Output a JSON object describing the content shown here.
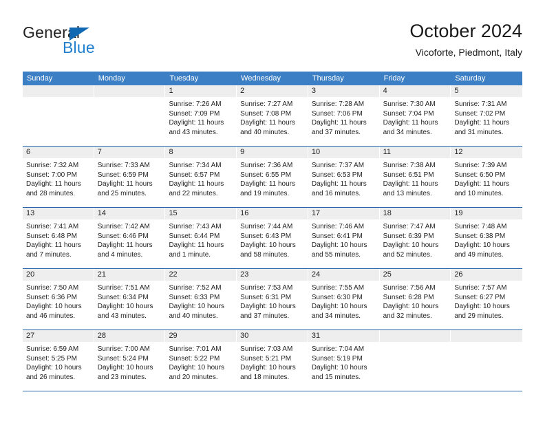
{
  "brand": {
    "name_dark": "General",
    "name_blue": "Blue",
    "accent_color": "#1068b3",
    "blue_text_color": "#1f7fd0"
  },
  "header": {
    "title": "October 2024",
    "subtitle": "Vicoforte, Piedmont, Italy"
  },
  "theme": {
    "header_row_bg": "#3c7fc4",
    "week_divider": "#1f62a8",
    "day_number_bg": "#eeeeee",
    "text_color": "#222222"
  },
  "weekdays": [
    "Sunday",
    "Monday",
    "Tuesday",
    "Wednesday",
    "Thursday",
    "Friday",
    "Saturday"
  ],
  "weeks": [
    [
      {
        "day": "",
        "empty": true,
        "sunrise": "",
        "sunset": "",
        "daylight_1": "",
        "daylight_2": ""
      },
      {
        "day": "",
        "empty": true,
        "sunrise": "",
        "sunset": "",
        "daylight_1": "",
        "daylight_2": ""
      },
      {
        "day": "1",
        "sunrise": "Sunrise: 7:26 AM",
        "sunset": "Sunset: 7:09 PM",
        "daylight_1": "Daylight: 11 hours",
        "daylight_2": "and 43 minutes."
      },
      {
        "day": "2",
        "sunrise": "Sunrise: 7:27 AM",
        "sunset": "Sunset: 7:08 PM",
        "daylight_1": "Daylight: 11 hours",
        "daylight_2": "and 40 minutes."
      },
      {
        "day": "3",
        "sunrise": "Sunrise: 7:28 AM",
        "sunset": "Sunset: 7:06 PM",
        "daylight_1": "Daylight: 11 hours",
        "daylight_2": "and 37 minutes."
      },
      {
        "day": "4",
        "sunrise": "Sunrise: 7:30 AM",
        "sunset": "Sunset: 7:04 PM",
        "daylight_1": "Daylight: 11 hours",
        "daylight_2": "and 34 minutes."
      },
      {
        "day": "5",
        "sunrise": "Sunrise: 7:31 AM",
        "sunset": "Sunset: 7:02 PM",
        "daylight_1": "Daylight: 11 hours",
        "daylight_2": "and 31 minutes."
      }
    ],
    [
      {
        "day": "6",
        "sunrise": "Sunrise: 7:32 AM",
        "sunset": "Sunset: 7:00 PM",
        "daylight_1": "Daylight: 11 hours",
        "daylight_2": "and 28 minutes."
      },
      {
        "day": "7",
        "sunrise": "Sunrise: 7:33 AM",
        "sunset": "Sunset: 6:59 PM",
        "daylight_1": "Daylight: 11 hours",
        "daylight_2": "and 25 minutes."
      },
      {
        "day": "8",
        "sunrise": "Sunrise: 7:34 AM",
        "sunset": "Sunset: 6:57 PM",
        "daylight_1": "Daylight: 11 hours",
        "daylight_2": "and 22 minutes."
      },
      {
        "day": "9",
        "sunrise": "Sunrise: 7:36 AM",
        "sunset": "Sunset: 6:55 PM",
        "daylight_1": "Daylight: 11 hours",
        "daylight_2": "and 19 minutes."
      },
      {
        "day": "10",
        "sunrise": "Sunrise: 7:37 AM",
        "sunset": "Sunset: 6:53 PM",
        "daylight_1": "Daylight: 11 hours",
        "daylight_2": "and 16 minutes."
      },
      {
        "day": "11",
        "sunrise": "Sunrise: 7:38 AM",
        "sunset": "Sunset: 6:51 PM",
        "daylight_1": "Daylight: 11 hours",
        "daylight_2": "and 13 minutes."
      },
      {
        "day": "12",
        "sunrise": "Sunrise: 7:39 AM",
        "sunset": "Sunset: 6:50 PM",
        "daylight_1": "Daylight: 11 hours",
        "daylight_2": "and 10 minutes."
      }
    ],
    [
      {
        "day": "13",
        "sunrise": "Sunrise: 7:41 AM",
        "sunset": "Sunset: 6:48 PM",
        "daylight_1": "Daylight: 11 hours",
        "daylight_2": "and 7 minutes."
      },
      {
        "day": "14",
        "sunrise": "Sunrise: 7:42 AM",
        "sunset": "Sunset: 6:46 PM",
        "daylight_1": "Daylight: 11 hours",
        "daylight_2": "and 4 minutes."
      },
      {
        "day": "15",
        "sunrise": "Sunrise: 7:43 AM",
        "sunset": "Sunset: 6:44 PM",
        "daylight_1": "Daylight: 11 hours",
        "daylight_2": "and 1 minute."
      },
      {
        "day": "16",
        "sunrise": "Sunrise: 7:44 AM",
        "sunset": "Sunset: 6:43 PM",
        "daylight_1": "Daylight: 10 hours",
        "daylight_2": "and 58 minutes."
      },
      {
        "day": "17",
        "sunrise": "Sunrise: 7:46 AM",
        "sunset": "Sunset: 6:41 PM",
        "daylight_1": "Daylight: 10 hours",
        "daylight_2": "and 55 minutes."
      },
      {
        "day": "18",
        "sunrise": "Sunrise: 7:47 AM",
        "sunset": "Sunset: 6:39 PM",
        "daylight_1": "Daylight: 10 hours",
        "daylight_2": "and 52 minutes."
      },
      {
        "day": "19",
        "sunrise": "Sunrise: 7:48 AM",
        "sunset": "Sunset: 6:38 PM",
        "daylight_1": "Daylight: 10 hours",
        "daylight_2": "and 49 minutes."
      }
    ],
    [
      {
        "day": "20",
        "sunrise": "Sunrise: 7:50 AM",
        "sunset": "Sunset: 6:36 PM",
        "daylight_1": "Daylight: 10 hours",
        "daylight_2": "and 46 minutes."
      },
      {
        "day": "21",
        "sunrise": "Sunrise: 7:51 AM",
        "sunset": "Sunset: 6:34 PM",
        "daylight_1": "Daylight: 10 hours",
        "daylight_2": "and 43 minutes."
      },
      {
        "day": "22",
        "sunrise": "Sunrise: 7:52 AM",
        "sunset": "Sunset: 6:33 PM",
        "daylight_1": "Daylight: 10 hours",
        "daylight_2": "and 40 minutes."
      },
      {
        "day": "23",
        "sunrise": "Sunrise: 7:53 AM",
        "sunset": "Sunset: 6:31 PM",
        "daylight_1": "Daylight: 10 hours",
        "daylight_2": "and 37 minutes."
      },
      {
        "day": "24",
        "sunrise": "Sunrise: 7:55 AM",
        "sunset": "Sunset: 6:30 PM",
        "daylight_1": "Daylight: 10 hours",
        "daylight_2": "and 34 minutes."
      },
      {
        "day": "25",
        "sunrise": "Sunrise: 7:56 AM",
        "sunset": "Sunset: 6:28 PM",
        "daylight_1": "Daylight: 10 hours",
        "daylight_2": "and 32 minutes."
      },
      {
        "day": "26",
        "sunrise": "Sunrise: 7:57 AM",
        "sunset": "Sunset: 6:27 PM",
        "daylight_1": "Daylight: 10 hours",
        "daylight_2": "and 29 minutes."
      }
    ],
    [
      {
        "day": "27",
        "sunrise": "Sunrise: 6:59 AM",
        "sunset": "Sunset: 5:25 PM",
        "daylight_1": "Daylight: 10 hours",
        "daylight_2": "and 26 minutes."
      },
      {
        "day": "28",
        "sunrise": "Sunrise: 7:00 AM",
        "sunset": "Sunset: 5:24 PM",
        "daylight_1": "Daylight: 10 hours",
        "daylight_2": "and 23 minutes."
      },
      {
        "day": "29",
        "sunrise": "Sunrise: 7:01 AM",
        "sunset": "Sunset: 5:22 PM",
        "daylight_1": "Daylight: 10 hours",
        "daylight_2": "and 20 minutes."
      },
      {
        "day": "30",
        "sunrise": "Sunrise: 7:03 AM",
        "sunset": "Sunset: 5:21 PM",
        "daylight_1": "Daylight: 10 hours",
        "daylight_2": "and 18 minutes."
      },
      {
        "day": "31",
        "sunrise": "Sunrise: 7:04 AM",
        "sunset": "Sunset: 5:19 PM",
        "daylight_1": "Daylight: 10 hours",
        "daylight_2": "and 15 minutes."
      },
      {
        "day": "",
        "empty": true,
        "sunrise": "",
        "sunset": "",
        "daylight_1": "",
        "daylight_2": ""
      },
      {
        "day": "",
        "empty": true,
        "sunrise": "",
        "sunset": "",
        "daylight_1": "",
        "daylight_2": ""
      }
    ]
  ]
}
